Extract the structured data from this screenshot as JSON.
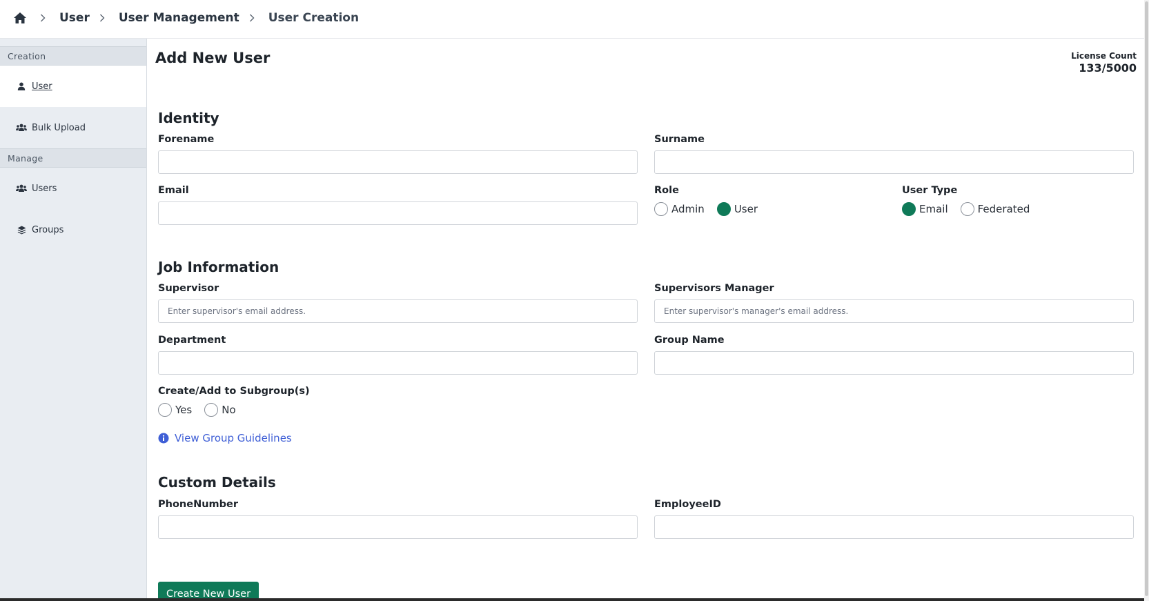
{
  "breadcrumb": {
    "items": [
      "User",
      "User Management",
      "User Creation"
    ]
  },
  "sidebar": {
    "creation_label": "Creation",
    "manage_label": "Manage",
    "items": [
      {
        "label": "User",
        "icon": "user-icon"
      },
      {
        "label": "Bulk Upload",
        "icon": "users-icon"
      },
      {
        "label": "Users",
        "icon": "users-icon"
      },
      {
        "label": "Groups",
        "icon": "layers-icon"
      }
    ]
  },
  "page": {
    "title": "Add New User",
    "license_label": "License Count",
    "license_value": "133/5000"
  },
  "identity": {
    "title": "Identity",
    "forename_label": "Forename",
    "surname_label": "Surname",
    "email_label": "Email",
    "role_label": "Role",
    "role_options": [
      "Admin",
      "User"
    ],
    "role_selected": "User",
    "user_type_label": "User Type",
    "user_type_options": [
      "Email",
      "Federated"
    ],
    "user_type_selected": "Email"
  },
  "job": {
    "title": "Job Information",
    "supervisor_label": "Supervisor",
    "supervisor_placeholder": "Enter supervisor's email address.",
    "supervisors_manager_label": "Supervisors Manager",
    "supervisors_manager_placeholder": "Enter supervisor's manager's email address.",
    "department_label": "Department",
    "group_name_label": "Group Name",
    "subgroup_label": "Create/Add to Subgroup(s)",
    "subgroup_options": [
      "Yes",
      "No"
    ],
    "guidelines_link": "View Group Guidelines"
  },
  "custom": {
    "title": "Custom Details",
    "phone_label": "PhoneNumber",
    "employee_label": "EmployeeID"
  },
  "actions": {
    "create_label": "Create New User"
  },
  "colors": {
    "accent": "#0f7a58",
    "link": "#3f5fd6"
  }
}
